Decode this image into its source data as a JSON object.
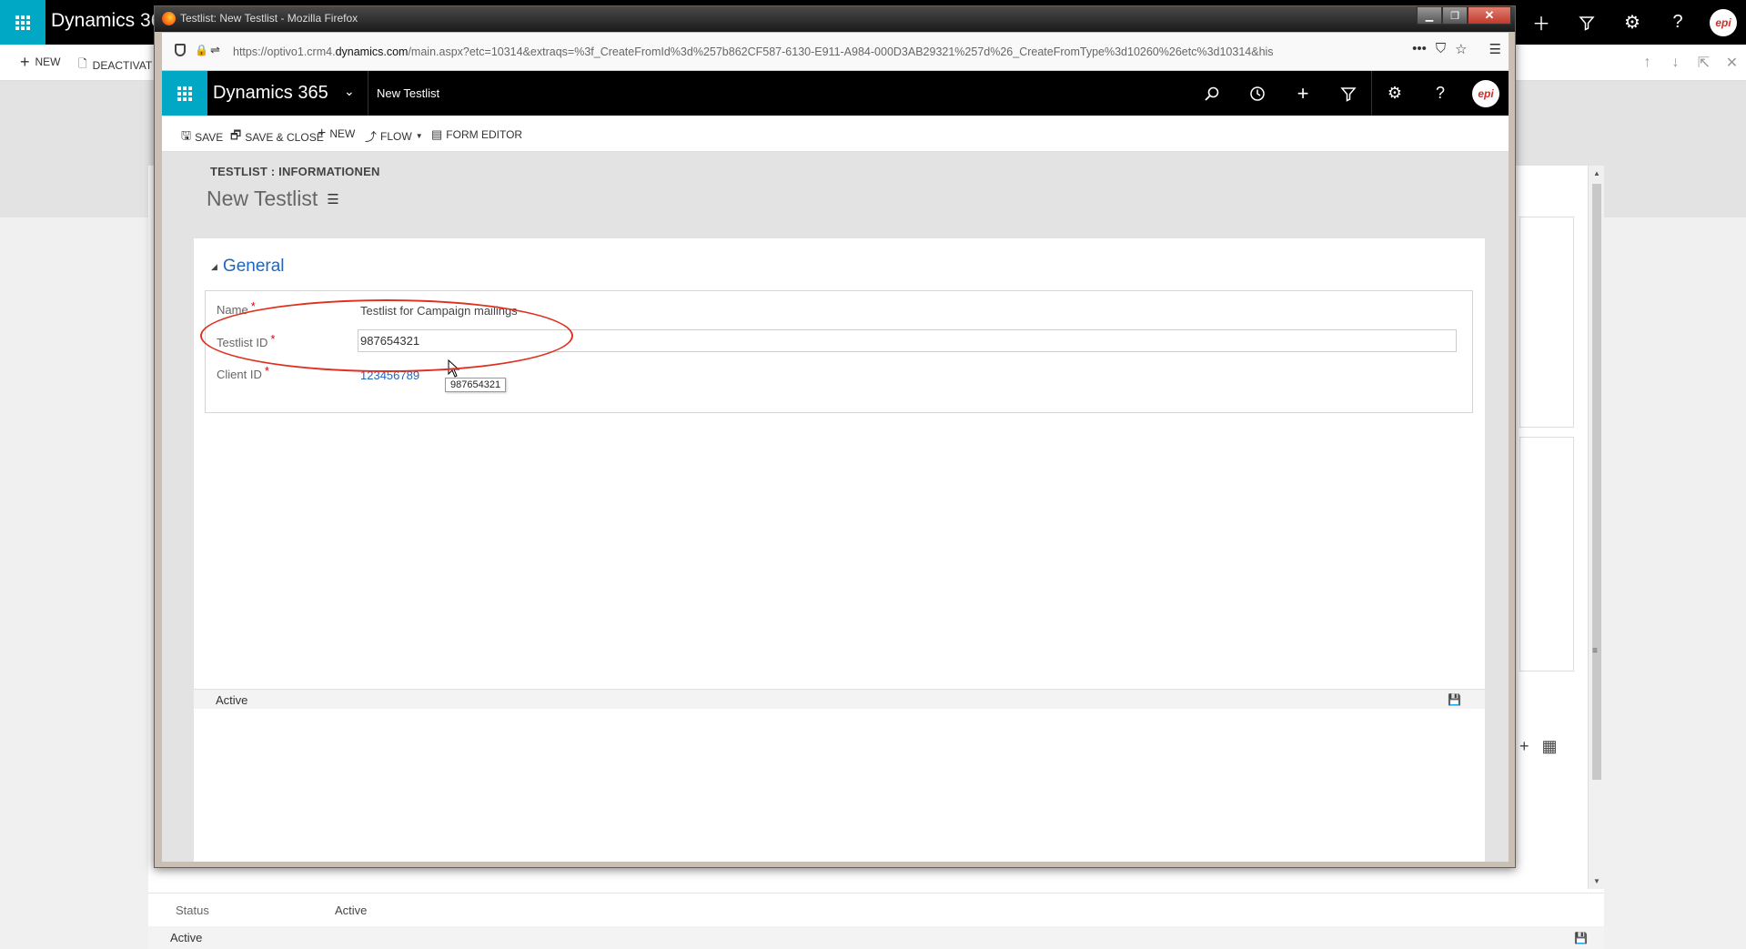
{
  "background": {
    "brand": "Dynamics 36",
    "commands": {
      "new": "NEW",
      "deactivate": "DEACTIVAT"
    },
    "footer_label": "Status",
    "footer_value": "Active",
    "status_text": "Active"
  },
  "window": {
    "title": "Testlist: New Testlist - Mozilla Firefox",
    "url_prefix": "https://optivo1.crm4.",
    "url_domain": "dynamics.com",
    "url_rest": "/main.aspx?etc=10314&extraqs=%3f_CreateFromId%3d%257b862CF587-6130-E911-A984-000D3AB29321%257d%26_CreateFromType%3d10260%26etc%3d10314&his",
    "url_more": "•••"
  },
  "app": {
    "brand": "Dynamics 365",
    "entity": "New Testlist",
    "avatar_text": "epi"
  },
  "toolbar": {
    "save": "SAVE",
    "save_close": "SAVE & CLOSE",
    "new": "NEW",
    "flow": "FLOW",
    "form_editor": "FORM EDITOR"
  },
  "form": {
    "breadcrumb": "TESTLIST : INFORMATIONEN",
    "title": "New Testlist",
    "section": "General",
    "fields": {
      "name_label": "Name",
      "name_value": "Testlist for Campaign mailings",
      "testlist_label": "Testlist ID",
      "testlist_value": "987654321",
      "client_label": "Client ID",
      "client_value": "123456789",
      "required_mark": "*"
    },
    "tooltip": "987654321",
    "status": "Active"
  },
  "colors": {
    "accent": "#00a8c6",
    "link": "#2266bb",
    "annotation": "#e03020"
  }
}
